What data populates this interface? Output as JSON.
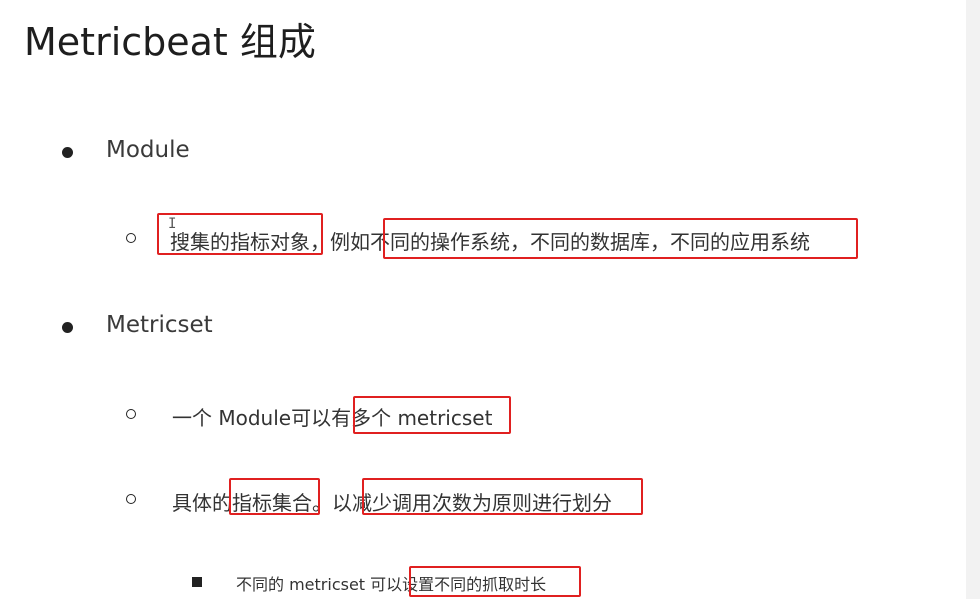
{
  "slide": {
    "title": "Metricbeat 组成",
    "module": {
      "label": "Module",
      "detail": {
        "part1": "搜集的指标对象",
        "sep": "，例如",
        "part2": "不同的操作系统，不同的数据库，不同的应用系统"
      }
    },
    "metricset": {
      "label": "Metricset",
      "item1": {
        "prefix": "一个 Module可以有",
        "highlight": "多个 metricset"
      },
      "item2": {
        "prefix": "具体的",
        "highlight1": "指标集合",
        "middle": "。以",
        "highlight2": "减少调用次数为原则进行划分"
      },
      "sub": {
        "prefix": "不同的 metricset 可以",
        "highlight": "设置不同的抓取时长"
      }
    }
  },
  "colors": {
    "highlight_box": "#e02020",
    "text": "#333333"
  },
  "icons": {
    "cursor": "text-cursor-icon"
  }
}
